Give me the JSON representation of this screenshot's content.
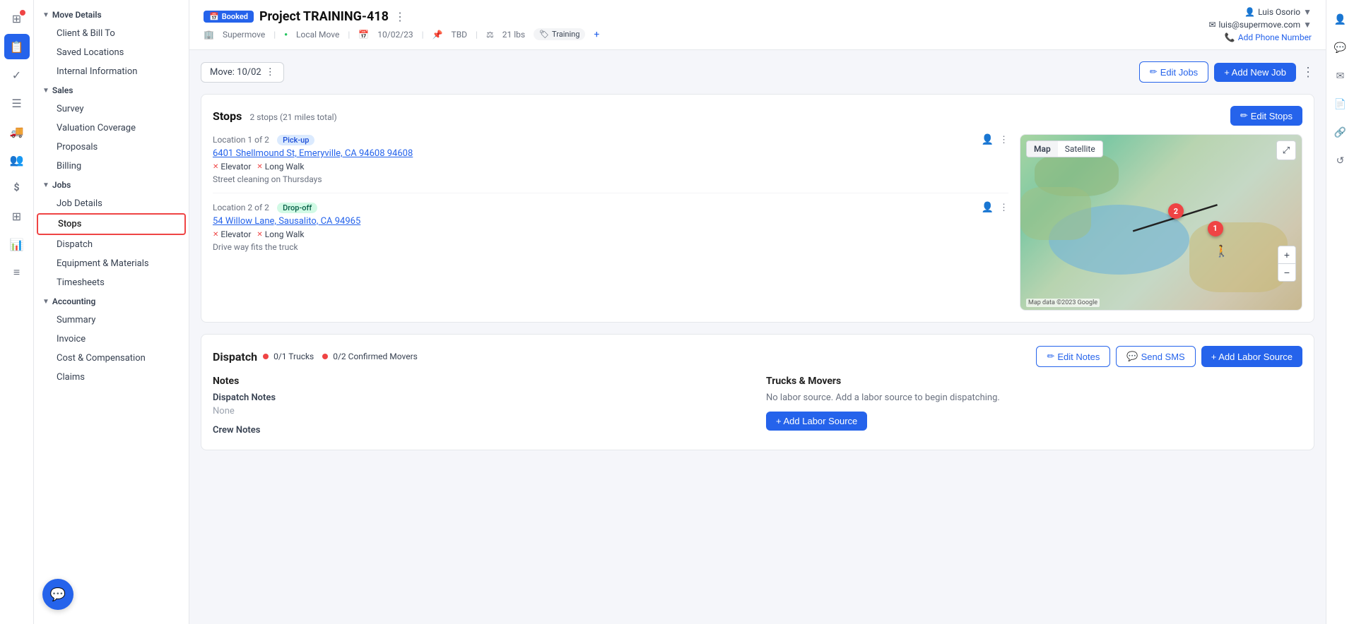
{
  "app": {
    "title": "SuperMove"
  },
  "left_nav_icons": [
    {
      "name": "home-icon",
      "symbol": "⊞",
      "active": false
    },
    {
      "name": "calendar-icon",
      "symbol": "📅",
      "active": true
    },
    {
      "name": "check-icon",
      "symbol": "✓",
      "active": false
    },
    {
      "name": "list-icon",
      "symbol": "☰",
      "active": false
    },
    {
      "name": "truck-icon",
      "symbol": "🚛",
      "active": false
    },
    {
      "name": "people-icon",
      "symbol": "👥",
      "active": false
    },
    {
      "name": "dollar-icon",
      "symbol": "$",
      "active": false
    },
    {
      "name": "grid-icon",
      "symbol": "⊞",
      "active": false
    },
    {
      "name": "chart-icon",
      "symbol": "📊",
      "active": false
    },
    {
      "name": "lines-icon",
      "symbol": "≡",
      "active": false
    }
  ],
  "sidebar": {
    "sections": [
      {
        "label": "Move Details",
        "expanded": true,
        "items": [
          {
            "label": "Client & Bill To",
            "active": false
          },
          {
            "label": "Saved Locations",
            "active": false
          },
          {
            "label": "Internal Information",
            "active": false
          }
        ]
      },
      {
        "label": "Sales",
        "expanded": true,
        "items": [
          {
            "label": "Survey",
            "active": false
          },
          {
            "label": "Valuation Coverage",
            "active": false
          },
          {
            "label": "Proposals",
            "active": false
          },
          {
            "label": "Billing",
            "active": false
          }
        ]
      },
      {
        "label": "Jobs",
        "expanded": true,
        "items": [
          {
            "label": "Job Details",
            "active": false
          },
          {
            "label": "Stops",
            "active": true
          },
          {
            "label": "Dispatch",
            "active": false
          },
          {
            "label": "Equipment & Materials",
            "active": false
          },
          {
            "label": "Timesheets",
            "active": false
          }
        ]
      },
      {
        "label": "Accounting",
        "expanded": true,
        "items": [
          {
            "label": "Summary",
            "active": false
          },
          {
            "label": "Invoice",
            "active": false
          },
          {
            "label": "Cost & Compensation",
            "active": false
          },
          {
            "label": "Claims",
            "active": false
          }
        ]
      }
    ]
  },
  "project": {
    "status_badge": "Booked",
    "title": "Project TRAINING-418",
    "company": "Supermove",
    "move_type": "Local Move",
    "date": "10/02/23",
    "time": "TBD",
    "weight": "21 lbs",
    "tag": "Training"
  },
  "user": {
    "name": "Luis Osorio",
    "email": "luis@supermove.com",
    "phone_label": "Add Phone Number"
  },
  "move_bar": {
    "label": "Move: 10/02",
    "edit_jobs_label": "Edit Jobs",
    "add_job_label": "+ Add New Job"
  },
  "stops_section": {
    "title": "Stops",
    "subtitle": "2 stops (21 miles total)",
    "edit_button": "Edit Stops",
    "stops": [
      {
        "location_label": "Location 1 of 2",
        "badge_type": "pickup",
        "badge_label": "Pick-up",
        "address": "6401 Shellmound St, Emeryville, CA 94608 94608",
        "tags": [
          {
            "label": "Elevator",
            "checked": false
          },
          {
            "label": "Long Walk",
            "checked": false
          }
        ],
        "note": "Street cleaning on Thursdays"
      },
      {
        "location_label": "Location 2 of 2",
        "badge_type": "dropoff",
        "badge_label": "Drop-off",
        "address": "54 Willow Lane, Sausalito, CA 94965",
        "tags": [
          {
            "label": "Elevator",
            "checked": false
          },
          {
            "label": "Long Walk",
            "checked": false
          }
        ],
        "note": "Drive way fits the truck"
      }
    ]
  },
  "map": {
    "tab_map": "Map",
    "tab_satellite": "Satellite",
    "attribution": "Map data ©2023 Google",
    "pin1_label": "1",
    "pin2_label": "2"
  },
  "dispatch_section": {
    "title": "Dispatch",
    "trucks_status": "0/1 Trucks",
    "movers_status": "0/2 Confirmed Movers",
    "edit_notes_label": "Edit Notes",
    "send_sms_label": "Send SMS",
    "add_labor_label": "+ Add Labor Source",
    "notes_title": "Notes",
    "dispatch_notes_label": "Dispatch Notes",
    "dispatch_notes_value": "None",
    "crew_notes_label": "Crew Notes",
    "trucks_movers_title": "Trucks & Movers",
    "no_labor_text": "No labor source. Add a labor source to begin dispatching.",
    "add_labor_btn": "+ Add Labor Source"
  },
  "right_sidebar": {
    "icons": [
      {
        "name": "person-icon",
        "symbol": "👤",
        "blue": true
      },
      {
        "name": "chat-bubble-icon",
        "symbol": "💬",
        "blue": true
      },
      {
        "name": "mail-icon",
        "symbol": "✉",
        "blue": false
      },
      {
        "name": "document-icon",
        "symbol": "📄",
        "blue": false
      },
      {
        "name": "link-icon",
        "symbol": "🔗",
        "blue": false
      },
      {
        "name": "refresh-icon",
        "symbol": "↺",
        "blue": false
      }
    ]
  }
}
